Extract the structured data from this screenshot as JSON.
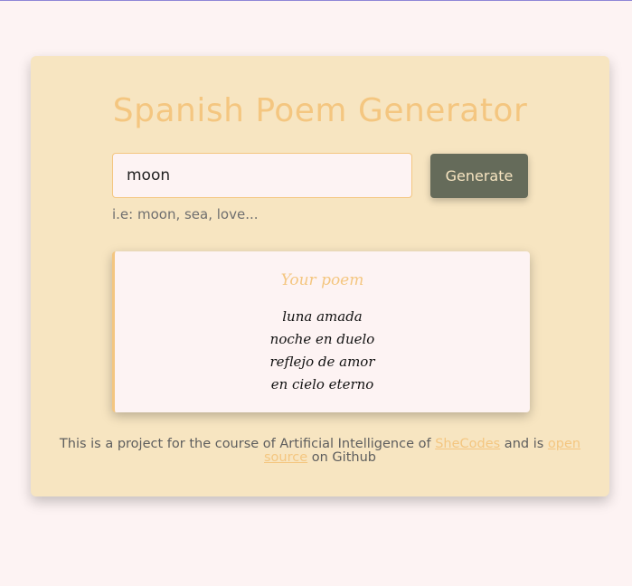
{
  "app": {
    "title": "Spanish Poem Generator"
  },
  "search": {
    "value": "moon",
    "hint": "i.e: moon, sea, love..."
  },
  "toolbar": {
    "generate_label": "Generate"
  },
  "poem": {
    "heading": "Your poem",
    "lines": [
      "luna amada",
      "noche en duelo",
      "reflejo de amor",
      "en cielo eterno"
    ]
  },
  "footer": {
    "text_before": "This is a project for the course of Artificial Intelligence of ",
    "shecodes_link": "SheCodes",
    "text_middle": " and is ",
    "open_source_link": "open source",
    "text_after": " on Github"
  },
  "colors": {
    "background": "#fdf3f3",
    "card": "#f7e5c1",
    "accent": "#f4c680",
    "button": "#656b5a"
  }
}
